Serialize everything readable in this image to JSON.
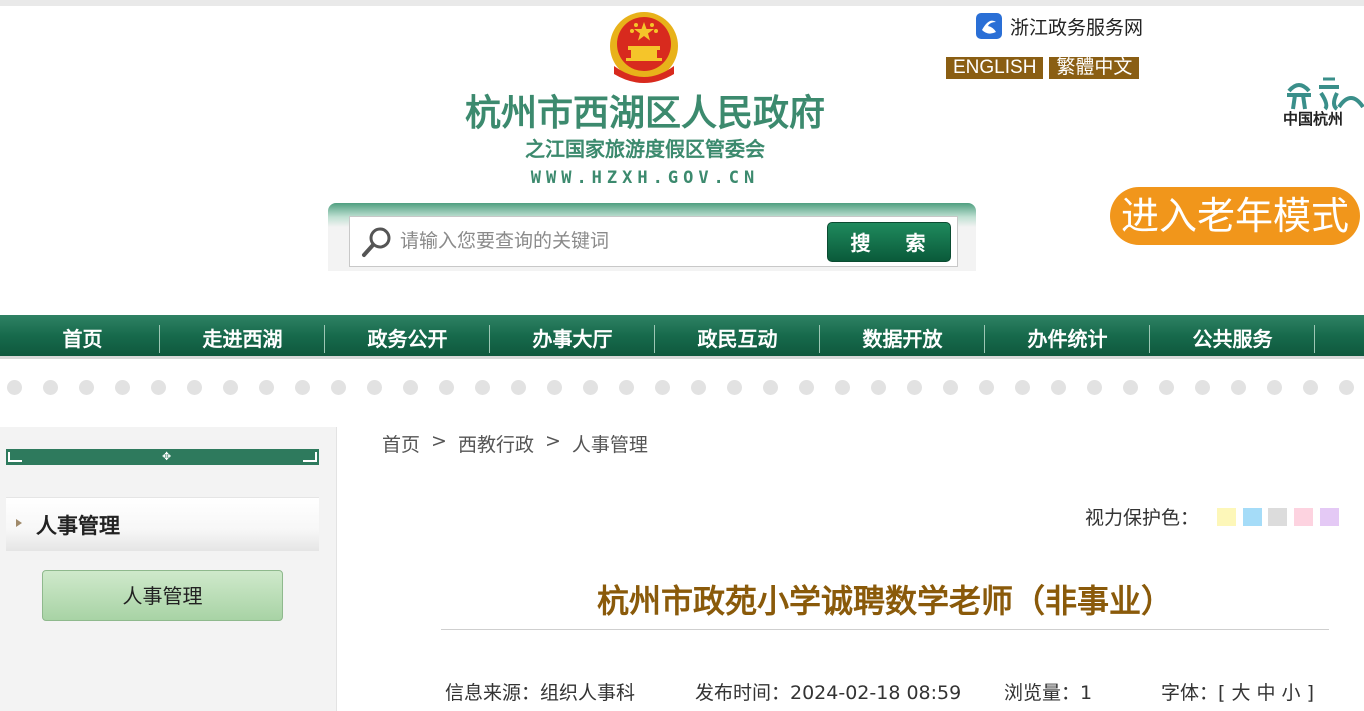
{
  "header": {
    "site_name": "杭州市西湖区人民政府",
    "site_sub": "之江国家旅游度假区管委会",
    "site_url": "WWW.HZXH.GOV.CN",
    "zj_link": "浙江政务服务网",
    "lang_english": "ENGLISH",
    "lang_traditional": "繁體中文",
    "hz_logo_text": "中国杭州",
    "elder_mode": "进入老年模式",
    "emblem_icon": "national-emblem-icon"
  },
  "search": {
    "placeholder": "请输入您要查询的关键词",
    "button": "搜 索"
  },
  "nav": {
    "items": [
      "首页",
      "走进西湖",
      "政务公开",
      "办事大厅",
      "政民互动",
      "数据开放",
      "办件统计",
      "公共服务"
    ]
  },
  "sidebar": {
    "heading": "人事管理",
    "items": [
      "人事管理"
    ]
  },
  "breadcrumb": {
    "items": [
      "首页",
      ">",
      "西教行政",
      ">",
      "人事管理"
    ]
  },
  "vision": {
    "label": "视力保护色：",
    "colors": [
      "#fdf7b9",
      "#a5dcf8",
      "#dcdcdc",
      "#fdd3e0",
      "#e4c9f5"
    ]
  },
  "article": {
    "title": "杭州市政苑小学诚聘数学老师（非事业）",
    "source": "信息来源：组织人事科",
    "published": "发布时间：2024-02-18 08:59",
    "views": "浏览量：1",
    "font_size": "字体：[ 大 中 小 ]"
  },
  "colors": {
    "brand_green": "#176a4c",
    "title_brown": "#8a5a0a",
    "elder_orange": "#f1961b",
    "lang_brown": "#8a5e13"
  }
}
